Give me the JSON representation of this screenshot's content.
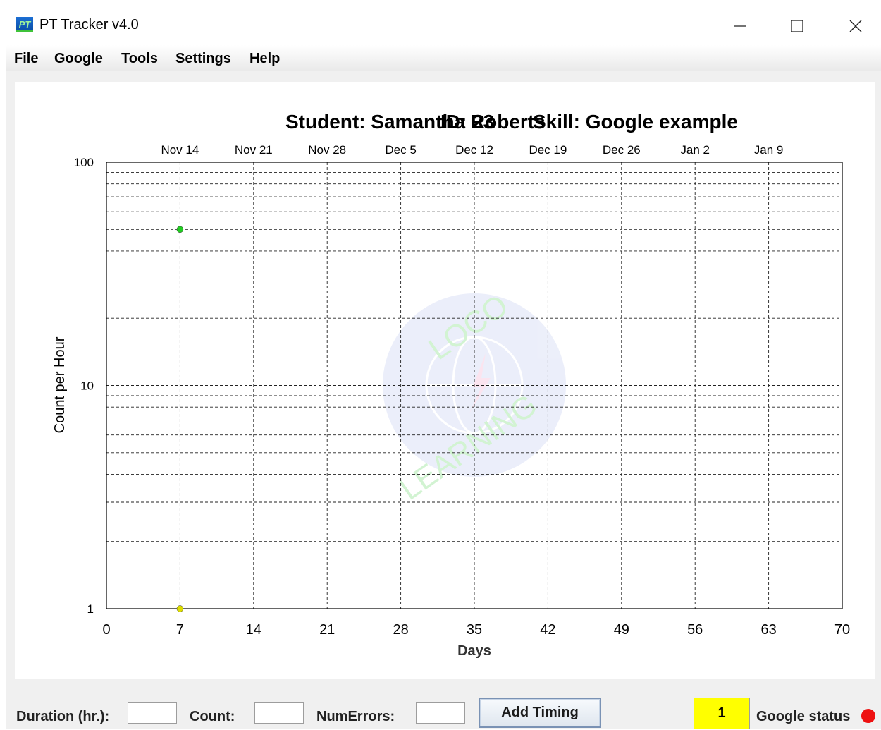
{
  "window": {
    "title": "PT Tracker v4.0",
    "icon_text": "PT",
    "icon": "pt-app-icon"
  },
  "window_controls": {
    "minimize_icon": "minimize-icon",
    "maximize_icon": "maximize-icon",
    "close_icon": "close-icon"
  },
  "menu": [
    {
      "label": "File"
    },
    {
      "label": "Google"
    },
    {
      "label": "Tools"
    },
    {
      "label": "Settings"
    },
    {
      "label": "Help"
    }
  ],
  "chart_header": {
    "student": "Student: Samantha Roberts",
    "id": "ID: 23",
    "skill": "Skill: Google example"
  },
  "chart_data": {
    "type": "scatter",
    "y_scale": "log",
    "ylim": [
      1,
      100
    ],
    "xlim": [
      0,
      70
    ],
    "y_tick_labels": [
      "100",
      "10",
      "1"
    ],
    "x_ticks": [
      0,
      7,
      14,
      21,
      28,
      35,
      42,
      49,
      56,
      63,
      70
    ],
    "top_date_labels": [
      "Nov 14",
      "Nov 21",
      "Nov 28",
      "Dec 5",
      "Dec 12",
      "Dec 19",
      "Dec 26",
      "Jan 2",
      "Jan 9"
    ],
    "xlabel": "Days",
    "ylabel": "Count per Hour",
    "grid": true,
    "grid_style": "dashed",
    "points": [
      {
        "x": 7,
        "y": 50,
        "color": "#22cc22"
      },
      {
        "x": 7,
        "y": 1,
        "color": "#dddd00"
      }
    ],
    "watermark_text": [
      "LOCO",
      "LEARNING"
    ]
  },
  "form": {
    "duration_label": "Duration (hr.):",
    "duration_value": "",
    "count_label": "Count:",
    "count_value": "",
    "errors_label": "NumErrors:",
    "errors_value": "",
    "add_button": "Add Timing",
    "counter_value": "1",
    "google_status_label": "Google status",
    "google_status_color": "#ee1111"
  }
}
